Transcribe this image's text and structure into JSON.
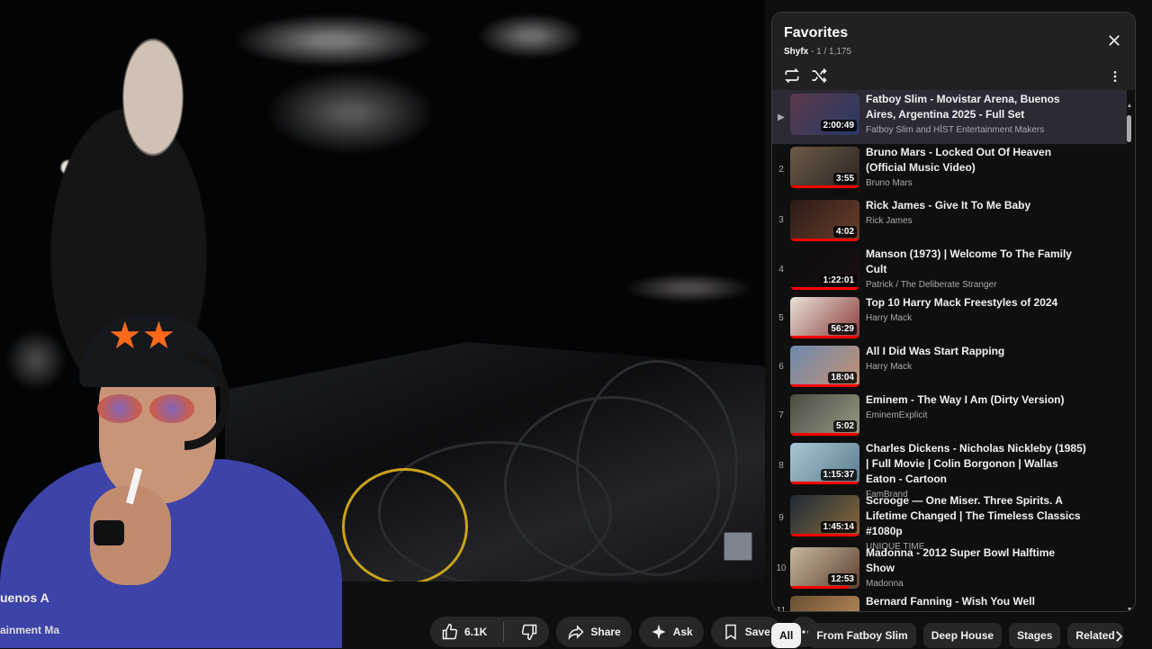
{
  "video": {
    "title_fragment": "uenos A",
    "channel_fragment": "ainment Ma"
  },
  "actions": {
    "like_count": "6.1K",
    "share_label": "Share",
    "ask_label": "Ask",
    "save_label": "Save"
  },
  "playlist": {
    "title": "Favorites",
    "owner": "Shyfx",
    "position": " - 1 / 1,175",
    "items": [
      {
        "index": "▶",
        "title": "Fatboy Slim - Movistar Arena, Buenos Aires, Argentina 2025 - Full Set",
        "channel": "Fatboy Slim and HÏST Entertainment Makers",
        "duration": "2:00:49",
        "thumb": [
          "#5b3a4a",
          "#263a66"
        ],
        "watched": 0.0
      },
      {
        "index": "2",
        "title": "Bruno Mars - Locked Out Of Heaven (Official Music Video)",
        "channel": "Bruno Mars",
        "duration": "3:55",
        "thumb": [
          "#6b5a48",
          "#2c2420"
        ],
        "watched": 1.0
      },
      {
        "index": "3",
        "title": "Rick James - Give It To Me Baby",
        "channel": "Rick James",
        "duration": "4:02",
        "thumb": [
          "#2a1a16",
          "#6a3f2d"
        ],
        "watched": 1.0
      },
      {
        "index": "4",
        "title": "Manson (1973) | Welcome To The Family Cult",
        "channel": "Patrick / The Deliberate Stranger",
        "duration": "1:22:01",
        "thumb": [
          "#0d0d0d",
          "#1a1010"
        ],
        "watched": 1.0
      },
      {
        "index": "5",
        "title": "Top 10 Harry Mack Freestyles of 2024",
        "channel": "Harry Mack",
        "duration": "56:29",
        "thumb": [
          "#e8e2d8",
          "#8a3a3a"
        ],
        "watched": 1.0
      },
      {
        "index": "6",
        "title": "All I Did Was Start Rapping",
        "channel": "Harry Mack",
        "duration": "18:04",
        "thumb": [
          "#6a8ab0",
          "#c89070"
        ],
        "watched": 1.0
      },
      {
        "index": "7",
        "title": "Eminem - The Way I Am (Dirty Version)",
        "channel": "EminemExplicit",
        "duration": "5:02",
        "thumb": [
          "#4a4a40",
          "#9a9a88"
        ],
        "watched": 1.0
      },
      {
        "index": "8",
        "title": "Charles Dickens - Nicholas Nickleby (1985) | Full Movie | Colin Borgonon | Wallas Eaton - Cartoon",
        "channel": "FamBrand",
        "duration": "1:15:37",
        "thumb": [
          "#a9c6d6",
          "#5a7b8c"
        ],
        "watched": 1.0
      },
      {
        "index": "9",
        "title": "Scrooge — One Miser. Three Spirits. A Lifetime Changed | The Timeless Classics #1080p",
        "channel": "UNIQUE TIME",
        "duration": "1:45:14",
        "thumb": [
          "#1d2a38",
          "#8a6a3a"
        ],
        "watched": 1.0
      },
      {
        "index": "10",
        "title": "Madonna - 2012 Super Bowl Halftime Show",
        "channel": "Madonna",
        "duration": "12:53",
        "thumb": [
          "#c8b8a0",
          "#5a4030"
        ],
        "watched": 0.85
      },
      {
        "index": "11",
        "title": "Bernard Fanning - Wish You Well",
        "channel": "",
        "duration": "",
        "thumb": [
          "#6a5030",
          "#c09060"
        ],
        "watched": 0.0
      }
    ]
  },
  "chips": [
    "All",
    "From Fatboy Slim",
    "Deep House",
    "Stages",
    "Related"
  ],
  "colors": {
    "accent_red": "#ff0000",
    "panel_bg": "#212121",
    "active_row": "#2d2a36",
    "pill_bg": "#272727"
  }
}
